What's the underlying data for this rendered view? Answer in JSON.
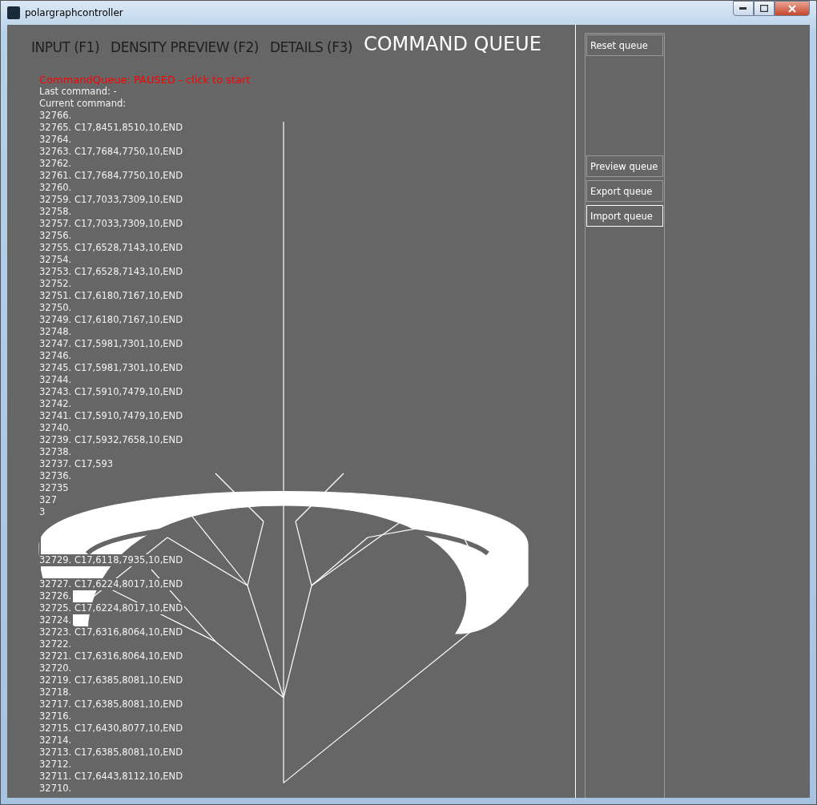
{
  "window": {
    "title": "polargraphcontroller"
  },
  "tabs": [
    {
      "label": "INPUT (F1)",
      "selected": false
    },
    {
      "label": "DENSITY PREVIEW (F2)",
      "selected": false
    },
    {
      "label": "DETAILS (F3)",
      "selected": false
    },
    {
      "label": "COMMAND QUEUE",
      "selected": true
    }
  ],
  "queue": {
    "status": "CommandQueue: PAUSED - click to start",
    "last_command": "Last command: -",
    "current_command": "Current command:",
    "rows": [
      {
        "text": "32766."
      },
      {
        "text": "32765. C17,8451,8510,10,END"
      },
      {
        "text": "32764."
      },
      {
        "text": "32763. C17,7684,7750,10,END"
      },
      {
        "text": "32762."
      },
      {
        "text": "32761. C17,7684,7750,10,END"
      },
      {
        "text": "32760."
      },
      {
        "text": "32759. C17,7033,7309,10,END"
      },
      {
        "text": "32758."
      },
      {
        "text": "32757. C17,7033,7309,10,END"
      },
      {
        "text": "32756."
      },
      {
        "text": "32755. C17,6528,7143,10,END"
      },
      {
        "text": "32754."
      },
      {
        "text": "32753. C17,6528,7143,10,END"
      },
      {
        "text": "32752."
      },
      {
        "text": "32751. C17,6180,7167,10,END"
      },
      {
        "text": "32750."
      },
      {
        "text": "32749. C17,6180,7167,10,END"
      },
      {
        "text": "32748."
      },
      {
        "text": "32747. C17,5981,7301,10,END"
      },
      {
        "text": "32746."
      },
      {
        "text": "32745. C17,5981,7301,10,END"
      },
      {
        "text": "32744."
      },
      {
        "text": "32743. C17,5910,7479,10,END"
      },
      {
        "text": "32742."
      },
      {
        "text": "32741. C17,5910,7479,10,END"
      },
      {
        "text": "32740."
      },
      {
        "text": "32739. C17,5932,7658,10,END"
      },
      {
        "text": "32738."
      },
      {
        "text": "32737. C17,593"
      },
      {
        "text": "32736."
      },
      {
        "text": "32735"
      },
      {
        "text": "327"
      },
      {
        "text": "3"
      },
      {
        "obscured": true
      },
      {
        "obscured": true
      },
      {
        "obscured": true
      },
      {
        "text": "32729. C17,6118,7935,10,END"
      },
      {
        "obscured": true
      },
      {
        "text": "32727. C17,6224,8017,10,END"
      },
      {
        "text": "32726."
      },
      {
        "text": "32725. C17,6224,8017,10,END"
      },
      {
        "text": "32724."
      },
      {
        "text": "32723. C17,6316,8064,10,END"
      },
      {
        "text": "32722."
      },
      {
        "text": "32721. C17,6316,8064,10,END"
      },
      {
        "text": "32720."
      },
      {
        "text": "32719. C17,6385,8081,10,END"
      },
      {
        "text": "32718."
      },
      {
        "text": "32717. C17,6385,8081,10,END"
      },
      {
        "text": "32716."
      },
      {
        "text": "32715. C17,6430,8077,10,END"
      },
      {
        "text": "32714."
      },
      {
        "text": "32713. C17,6385,8081,10,END"
      },
      {
        "text": "32712."
      },
      {
        "text": "32711. C17,6443,8112,10,END"
      },
      {
        "text": "32710."
      }
    ]
  },
  "top_buttons": [
    {
      "label": "Reset queue",
      "highlighted": false
    }
  ],
  "bottom_buttons": [
    {
      "label": "Preview queue",
      "highlighted": false
    },
    {
      "label": "Export queue",
      "highlighted": false
    },
    {
      "label": "Import queue",
      "highlighted": true
    }
  ]
}
